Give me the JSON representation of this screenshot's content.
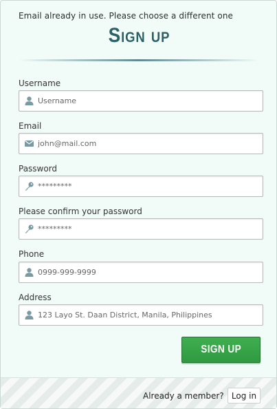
{
  "error_message": "Email already in use. Please choose a different one",
  "title": "Sign up",
  "fields": [
    {
      "label": "Username",
      "placeholder": "Username",
      "icon": "user-icon"
    },
    {
      "label": "Email",
      "placeholder": "john@mail.com",
      "icon": "envelope-icon"
    },
    {
      "label": "Password",
      "placeholder": "*********",
      "icon": "key-icon"
    },
    {
      "label": "Please confirm your password",
      "placeholder": "*********",
      "icon": "key-icon"
    },
    {
      "label": "Phone",
      "placeholder": "0999-999-9999",
      "icon": "user-icon"
    },
    {
      "label": "Address",
      "placeholder": "123 Layo St. Daan District, Manila, Philippines",
      "icon": "user-icon"
    }
  ],
  "signup_button": "SIGN UP",
  "footer": {
    "member_text": "Already a member?",
    "login_button": "Log in"
  },
  "colors": {
    "background": "#f1fcf8",
    "title": "#2b6166",
    "button": "#3fae50",
    "icon": "#7a9aa2"
  }
}
